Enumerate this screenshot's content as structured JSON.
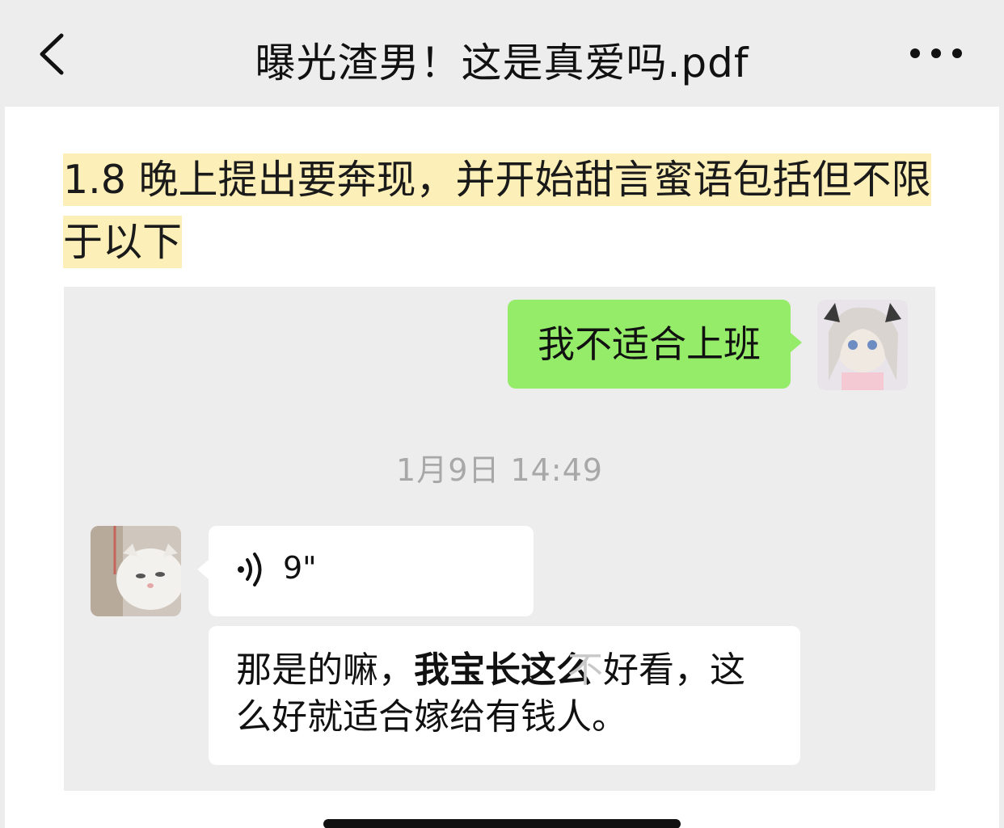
{
  "nav": {
    "title": "曝光渣男！这是真爱吗.pdf",
    "back_icon": "chevron-left-icon",
    "more_icon": "more-dots-icon"
  },
  "document": {
    "paragraph": "1.8 晚上提出要奔现，并开始甜言蜜语包括但不限于以下",
    "highlight_color": "#fcefb8"
  },
  "chat": {
    "outgoing_message": "我不适合上班",
    "outgoing_bubble_color": "#95ec69",
    "timestamp": "1月9日 14:49",
    "voice_duration": "9\"",
    "incoming_text_part1": "那是的嘛，",
    "incoming_text_bold": "我宝长这么",
    "incoming_text_faint": "不",
    "incoming_text_part2": "好看，这么好就适合嫁给有钱人。"
  }
}
